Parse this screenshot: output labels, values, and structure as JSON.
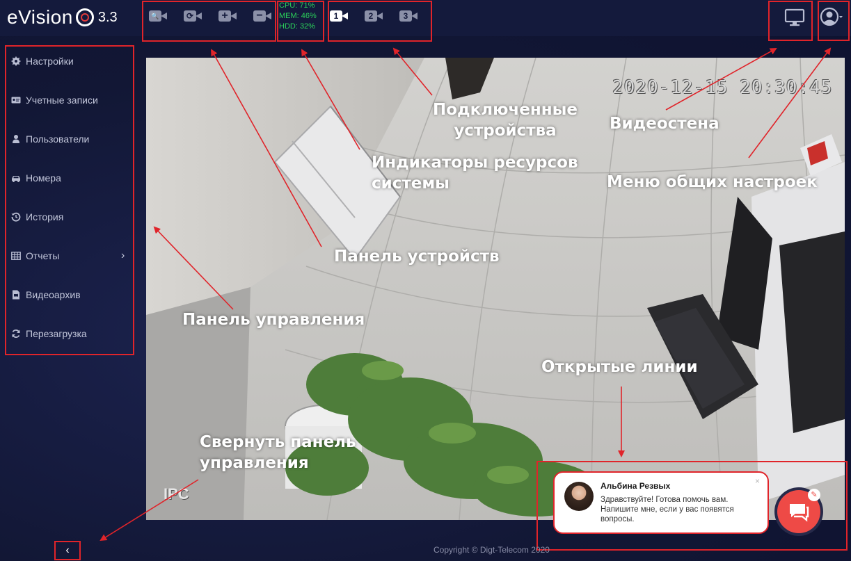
{
  "app": {
    "logo_text": "eVision",
    "version": "3.3"
  },
  "toolbar": {
    "device_buttons": [
      {
        "icon": "search-camera-icon",
        "glyph": "🔍"
      },
      {
        "icon": "refresh-camera-icon",
        "glyph": "⟳"
      },
      {
        "icon": "add-camera-icon",
        "glyph": "+"
      },
      {
        "icon": "remove-camera-icon",
        "glyph": "−"
      }
    ],
    "stats": {
      "cpu": "CPU: 71%",
      "mem": "MEM: 46%",
      "hdd": "HDD: 32%"
    },
    "connected_devices": [
      {
        "label": "1",
        "active": true
      },
      {
        "label": "2",
        "active": false
      },
      {
        "label": "3",
        "active": false
      }
    ]
  },
  "sidebar": {
    "items": [
      {
        "label": "Настройки",
        "icon": "gear-icon"
      },
      {
        "label": "Учетные записи",
        "icon": "id-card-icon"
      },
      {
        "label": "Пользователи",
        "icon": "user-icon"
      },
      {
        "label": "Номера",
        "icon": "car-icon"
      },
      {
        "label": "История",
        "icon": "history-icon"
      },
      {
        "label": "Отчеты",
        "icon": "table-icon",
        "has_submenu": true
      },
      {
        "label": "Видеоархив",
        "icon": "video-file-icon"
      },
      {
        "label": "Перезагрузка",
        "icon": "reload-icon"
      }
    ]
  },
  "video": {
    "timestamp": "2020-12-15 20:30:45",
    "camera_label": "IPC"
  },
  "annotations": {
    "connected_devices": "Подключенные\nустройства",
    "video_wall": "Видеостена",
    "resource_indicators": "Индикаторы ресурсов\nсистемы",
    "general_settings_menu": "Меню общих настроек",
    "device_panel": "Панель устройств",
    "control_panel": "Панель управления",
    "open_lines": "Открытые линии",
    "collapse_panel": "Свернуть панель\nуправления"
  },
  "chat": {
    "agent_name": "Альбина Резвых",
    "message": "Здравствуйте! Готова помочь вам. Напишите мне, если у вас появятся вопросы.",
    "close_glyph": "×"
  },
  "footer": {
    "collapse_glyph": "‹",
    "copyright": "Copyright © Digt-Telecom 2020"
  },
  "colors": {
    "highlight": "#e0242a",
    "stats_green": "#2bd25a",
    "chat_accent": "#ee4a46",
    "background": "#141a3c"
  }
}
